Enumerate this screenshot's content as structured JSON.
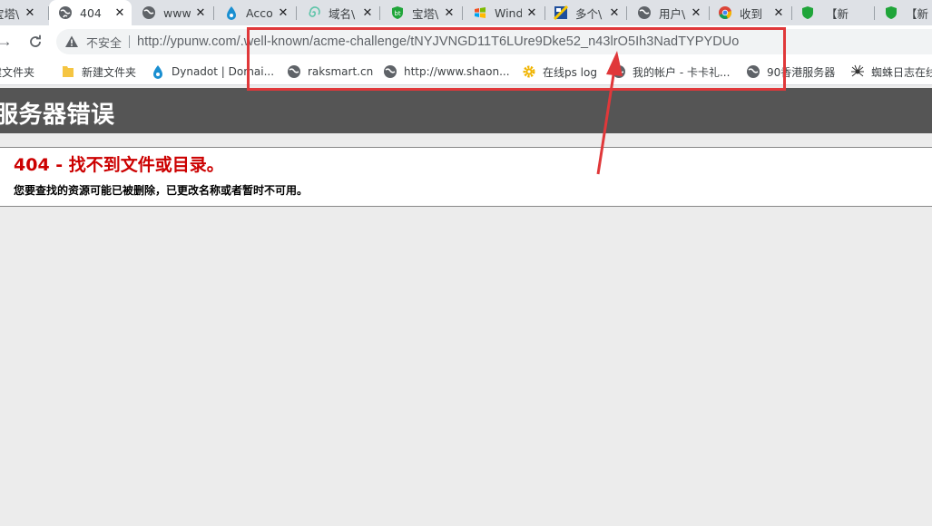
{
  "tabs": [
    {
      "title": "宝塔\\",
      "icon": "bt-shield-icon",
      "active": false
    },
    {
      "title": "404",
      "icon": "globe-icon",
      "active": true
    },
    {
      "title": "www.",
      "icon": "globe-icon",
      "active": false
    },
    {
      "title": "Acco",
      "icon": "dynadot-icon",
      "active": false
    },
    {
      "title": "域名\\",
      "icon": "spiral-icon",
      "active": false
    },
    {
      "title": "宝塔\\",
      "icon": "bt-shield-icon",
      "active": false
    },
    {
      "title": "Wind",
      "icon": "windows-icon",
      "active": false
    },
    {
      "title": "多个\\",
      "icon": "image-icon",
      "active": false
    },
    {
      "title": "用户\\",
      "icon": "globe-icon",
      "active": false
    },
    {
      "title": "收到",
      "icon": "chrome-icon",
      "active": false
    },
    {
      "title": "",
      "icon": "bt-shield-icon",
      "active": false
    },
    {
      "title": "【新",
      "icon": "",
      "active": false
    },
    {
      "title": "【新",
      "icon": "bt-shield-icon",
      "active": false
    }
  ],
  "toolbar": {
    "insecure_label": "不安全",
    "url_host": "http://ypunw.com",
    "url_path": "/.well-known/acme-challenge/tNYJVNGD11T6LUre9Dke52_n43lrO5Ih3NadTYPYDUo"
  },
  "bookmarks": [
    {
      "label": "建文件夹",
      "icon": "folder-icon"
    },
    {
      "label": "新建文件夹",
      "icon": "folder-icon"
    },
    {
      "label": "Dynadot | Domai...",
      "icon": "dynadot-icon"
    },
    {
      "label": "raksmart.cn",
      "icon": "globe-icon"
    },
    {
      "label": "http://www.shaon...",
      "icon": "globe-icon"
    },
    {
      "label": "在线ps log",
      "icon": "gear-icon"
    },
    {
      "label": "我的帐户 - 卡卡礼...",
      "icon": "globe-icon"
    },
    {
      "label": "90香港服务器",
      "icon": "globe-icon"
    },
    {
      "label": "蜘蛛日志在线",
      "icon": "spider-icon"
    }
  ],
  "page": {
    "header_title": "服务器错误",
    "error_code": "404 - 找不到文件或目录。",
    "error_description": "您要查找的资源可能已被删除，已更改名称或者暂时不可用。"
  },
  "colors": {
    "annotation": "#e0383a",
    "error_red": "#cc0000",
    "header_band": "#555555"
  }
}
